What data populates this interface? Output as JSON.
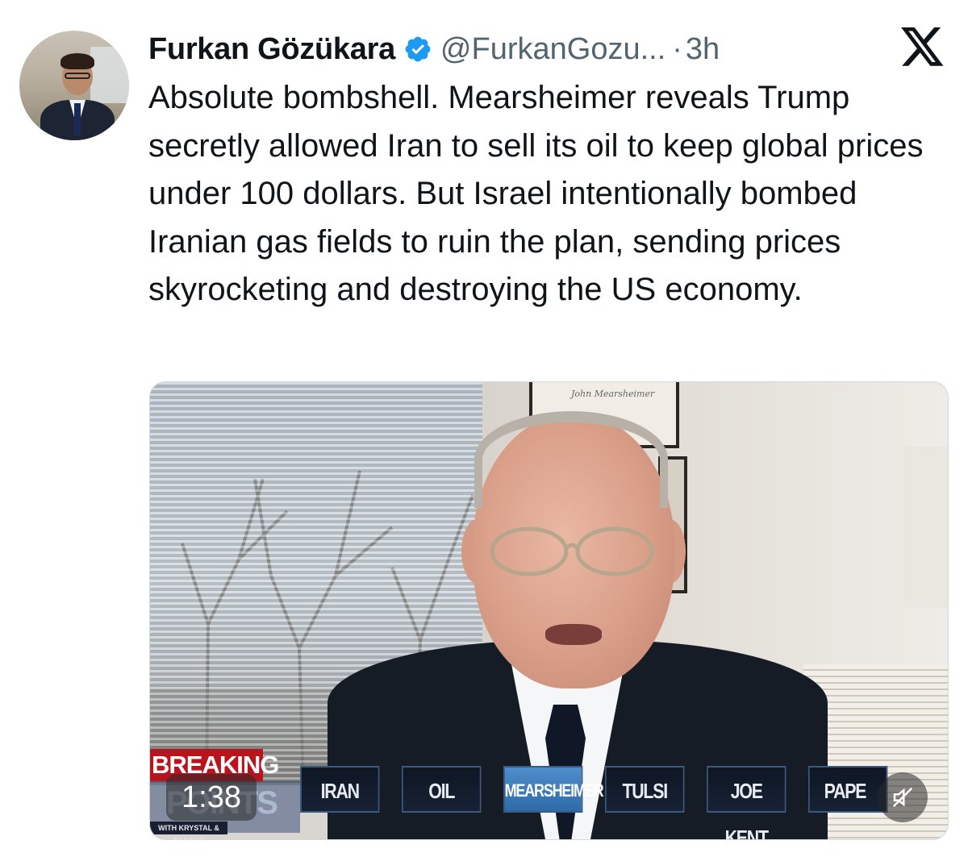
{
  "author": {
    "name": "Furkan Gözükara",
    "handle": "@FurkanGozu...",
    "separator": "·",
    "time": "3h",
    "verified_icon": "verified-badge-icon",
    "colors": {
      "verified": "#1d9bf0",
      "handle": "#536471"
    }
  },
  "platform_icon": "x-logo-icon",
  "tweet": {
    "text": "Absolute bombshell. Mearsheimer reveals Trump secretly allowed Iran to sell its oil to keep global prices under 100 dollars. But Israel intentionally bombed Iranian gas fields to ruin the plan, sending prices skyrocketing and destroying the US economy."
  },
  "video": {
    "duration": "1:38",
    "mute_icon": "muted-speaker-icon",
    "overlay": {
      "breaking_label": "BREAKING",
      "show_logo_text": "POINTS",
      "show_subtitle": "WITH KRYSTAL & SAAGAR",
      "frame_signature": "John Mearsheimer",
      "topic_tabs": [
        {
          "label": "IRAN",
          "active": false
        },
        {
          "label": "OIL",
          "active": false
        },
        {
          "label": "MEARSHEIMER",
          "active": true
        },
        {
          "label": "TULSI",
          "active": false
        },
        {
          "label": "JOE KENT",
          "active": false
        },
        {
          "label": "PAPE",
          "active": false
        }
      ],
      "colors": {
        "breaking": "#b8141e",
        "active_tab": "#3f7fbf"
      }
    }
  }
}
